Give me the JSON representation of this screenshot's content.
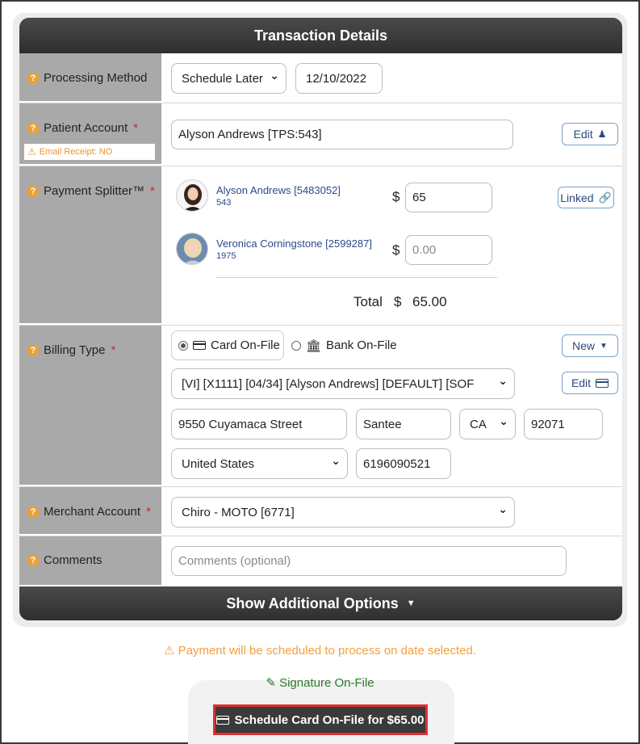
{
  "header": {
    "title": "Transaction Details"
  },
  "processing": {
    "label": "Processing Method",
    "method_value": "Schedule Later",
    "date_value": "12/10/2022"
  },
  "patient": {
    "label": "Patient Account",
    "email_receipt": "Email Receipt: NO",
    "account_value": "Alyson Andrews [TPS:543]",
    "edit_label": "Edit"
  },
  "splitter": {
    "label": "Payment Splitter™",
    "linked_label": "Linked",
    "people": [
      {
        "name": "Alyson Andrews [5483052]",
        "sub": "543",
        "amount": "65",
        "placeholder": ""
      },
      {
        "name": "Veronica Corningstone [2599287]",
        "sub": "1975",
        "amount": "",
        "placeholder": "0.00"
      }
    ],
    "currency": "$",
    "total_label": "Total",
    "total_value": "65.00"
  },
  "billing": {
    "label": "Billing Type",
    "options": [
      "Card On-File",
      "Bank On-File"
    ],
    "selected": "Card On-File",
    "new_label": "New",
    "card_value": "[VI] [X1111] [04/34] [Alyson Andrews] [DEFAULT] [SOF",
    "edit_label": "Edit",
    "street": "9550 Cuyamaca Street",
    "city": "Santee",
    "state": "CA",
    "zip": "92071",
    "country": "United States",
    "phone": "6196090521"
  },
  "merchant": {
    "label": "Merchant Account",
    "value": "Chiro - MOTO [6771]"
  },
  "comments": {
    "label": "Comments",
    "placeholder": "Comments (optional)"
  },
  "additional": {
    "label": "Show Additional Options"
  },
  "notice": "Payment will be scheduled to process on date selected.",
  "signature": "Signature On-File",
  "submit_label": "Schedule Card On-File for $65.00",
  "colors": {
    "accent_orange": "#f0a030",
    "required_red": "#e02020",
    "link_blue": "#2a4a8a",
    "signature_green": "#2a7a2a"
  }
}
